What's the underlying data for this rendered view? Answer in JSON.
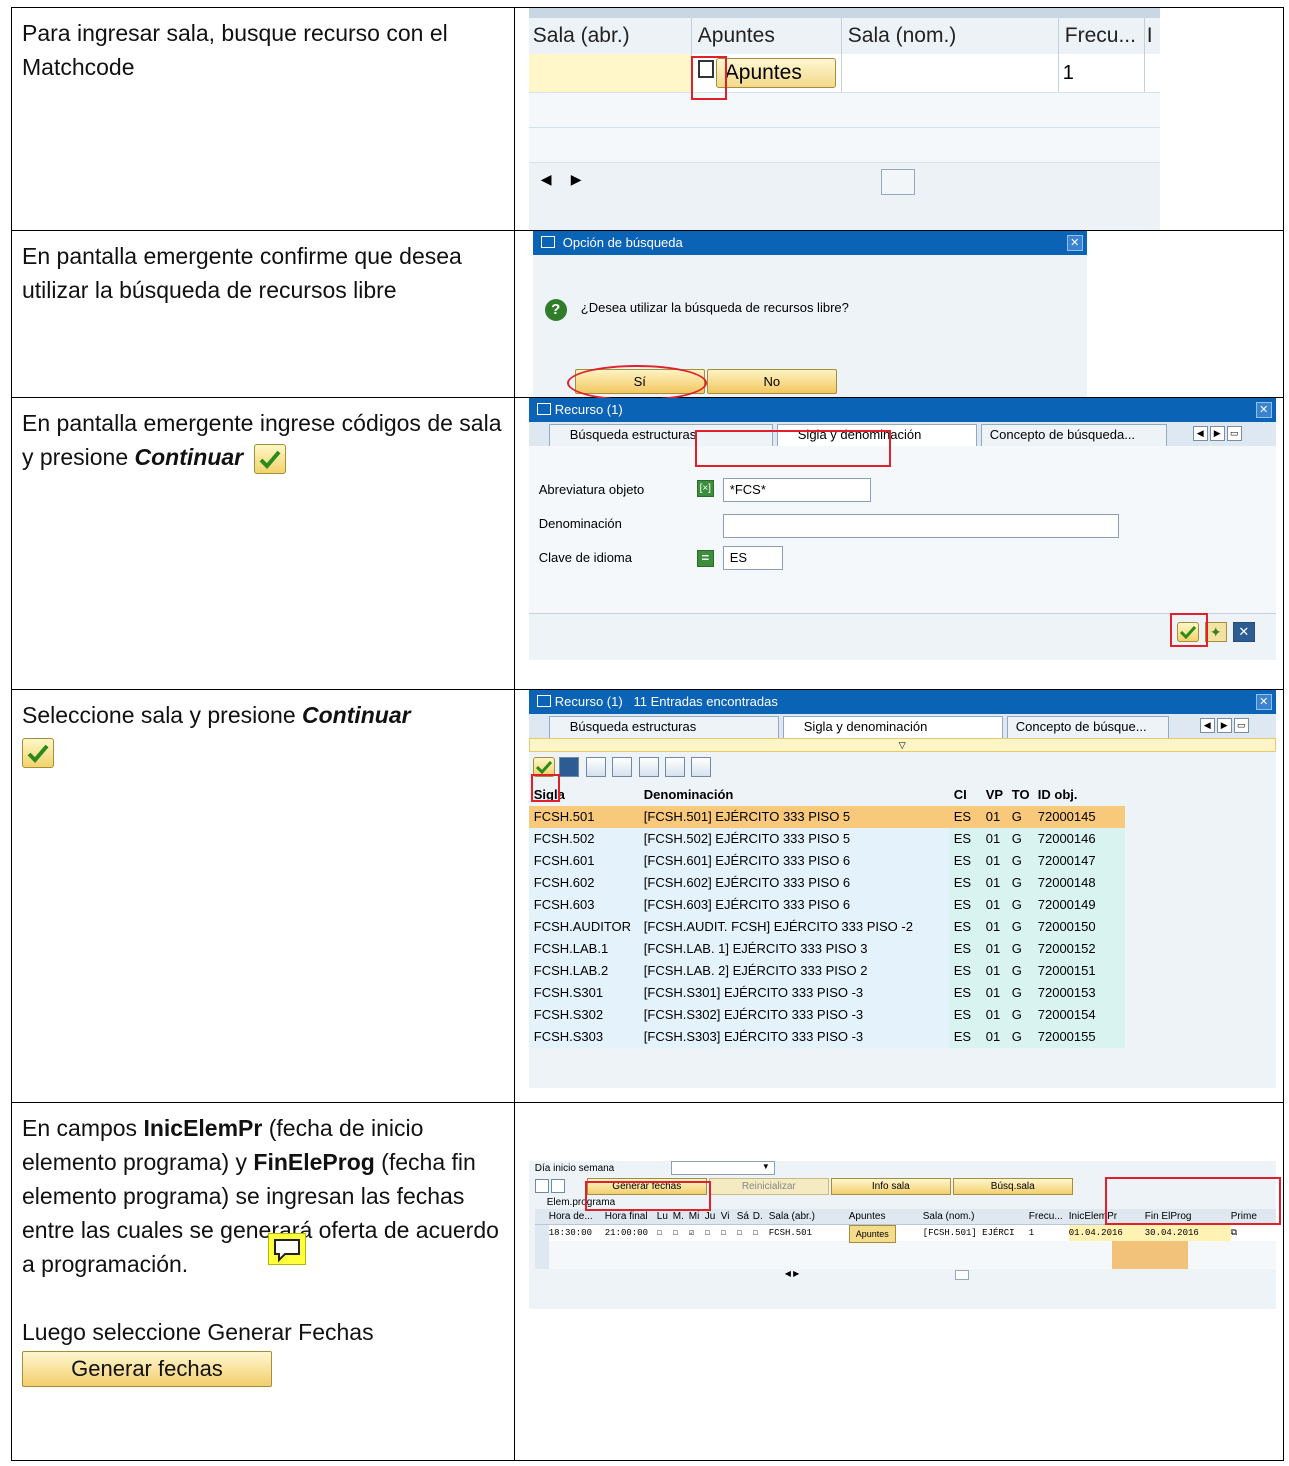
{
  "rows": [
    {
      "instruction": "Para ingresar sala, busque recurso con el Matchcode"
    },
    {
      "instruction": "En pantalla emergente confirme que desea utilizar la búsqueda de recursos libre"
    },
    {
      "instruction_pre": "En pantalla emergente ingrese códigos de sala y presione ",
      "instruction_bold": "Continuar"
    },
    {
      "instruction_pre": "Seleccione sala y presione ",
      "instruction_bold": "Continuar"
    },
    {
      "p1": "En campos ",
      "b1": "InicElemPr",
      "p2": " (fecha de inicio elemento programa) y ",
      "b2": "FinEleProg",
      "p3": " (fecha fin elemento programa) se ingresan las fechas entre las cuales se generará oferta de acuerdo a programación.",
      "p4": "Luego seleccione Generar Fechas",
      "generate_button": "Generar fechas"
    }
  ],
  "shot1": {
    "headers": [
      "Sala (abr.)",
      "Apuntes",
      "Sala (nom.)",
      "Frecu...",
      "I"
    ],
    "apuntes_button": "Apuntes",
    "frecuencia": "1"
  },
  "shot2": {
    "title": "Opción de búsqueda",
    "question": "¿Desea utilizar la búsqueda de recursos libre?",
    "yes": "Sí",
    "no": "No"
  },
  "shot3": {
    "title": "Recurso (1)",
    "tabs": [
      "Búsqueda estructuras",
      "Sigla y denominación",
      "Concepto de búsqueda..."
    ],
    "fields": [
      {
        "label": "Abreviatura objeto",
        "value": "*FCS*"
      },
      {
        "label": "Denominación",
        "value": ""
      },
      {
        "label": "Clave de idioma",
        "value": "ES"
      }
    ]
  },
  "shot4": {
    "title": "Recurso (1)",
    "found": "11 Entradas encontradas",
    "tabs": [
      "Búsqueda estructuras",
      "Sigla y denominación",
      "Concepto de búsque..."
    ],
    "columns": [
      "Sigla",
      "Denominación",
      "CI",
      "VP",
      "TO",
      "ID obj."
    ],
    "rows": [
      [
        "FCSH.501",
        "[FCSH.501]  EJÉRCITO 333 PISO 5",
        "ES",
        "01",
        "G",
        "72000145"
      ],
      [
        "FCSH.502",
        "[FCSH.502]  EJÉRCITO 333 PISO 5",
        "ES",
        "01",
        "G",
        "72000146"
      ],
      [
        "FCSH.601",
        "[FCSH.601] EJÉRCITO 333 PISO 6",
        "ES",
        "01",
        "G",
        "72000147"
      ],
      [
        "FCSH.602",
        "[FCSH.602] EJÉRCITO 333 PISO 6",
        "ES",
        "01",
        "G",
        "72000148"
      ],
      [
        "FCSH.603",
        "[FCSH.603] EJÉRCITO 333 PISO 6",
        "ES",
        "01",
        "G",
        "72000149"
      ],
      [
        "FCSH.AUDITOR",
        "[FCSH.AUDIT. FCSH]  EJÉRCITO 333 PISO -2",
        "ES",
        "01",
        "G",
        "72000150"
      ],
      [
        "FCSH.LAB.1",
        "[FCSH.LAB. 1]  EJÉRCITO 333 PISO 3",
        "ES",
        "01",
        "G",
        "72000152"
      ],
      [
        "FCSH.LAB.2",
        "[FCSH.LAB. 2]  EJÉRCITO 333 PISO 2",
        "ES",
        "01",
        "G",
        "72000151"
      ],
      [
        "FCSH.S301",
        "[FCSH.S301]  EJÉRCITO 333 PISO -3",
        "ES",
        "01",
        "G",
        "72000153"
      ],
      [
        "FCSH.S302",
        "[FCSH.S302]  EJÉRCITO 333 PISO -3",
        "ES",
        "01",
        "G",
        "72000154"
      ],
      [
        "FCSH.S303",
        "[FCSH.S303]  EJÉRCITO 333 PISO -3",
        "ES",
        "01",
        "G",
        "72000155"
      ]
    ]
  },
  "shot5": {
    "day_label": "Día inicio semana",
    "buttons": [
      "Generar fechas",
      "Reinicializar",
      "Info sala",
      "Búsq.sala"
    ],
    "elem_label": "Elem.programa",
    "headers": [
      "Hora de...",
      "Hora final",
      "Lu",
      "M.",
      "Mi",
      "Ju",
      "Vi",
      "Sá",
      "D.",
      "Sala (abr.)",
      "Apuntes",
      "Sala (nom.)",
      "Frecu...",
      "InicElemPr",
      "Fin ElProg",
      "Prime"
    ],
    "row": {
      "hora_inicio": "18:30:00",
      "hora_final": "21:00:00",
      "sala_abr": "FCSH.501",
      "apuntes": "Apuntes",
      "sala_nom": "[FCSH.501]  EJÉRCI",
      "frecuencia": "1",
      "inicio": "01.04.2016",
      "fin": "30.04.2016"
    }
  }
}
